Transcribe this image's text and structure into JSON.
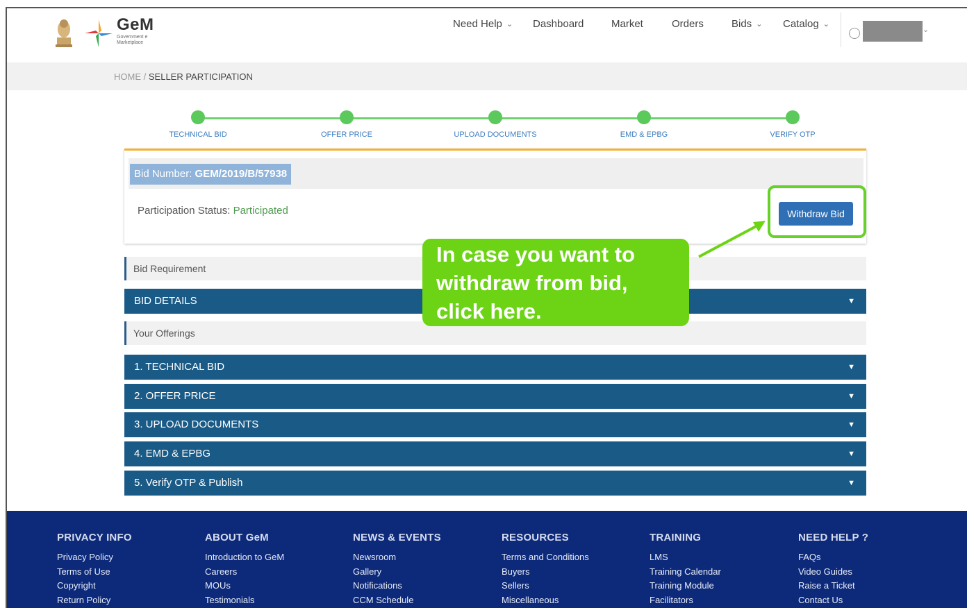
{
  "header": {
    "logo_text": "GeM",
    "logo_sub": "Government e Marketplace",
    "nav": [
      {
        "label": "Need Help",
        "dropdown": true
      },
      {
        "label": "Dashboard",
        "dropdown": false
      },
      {
        "label": "Market",
        "dropdown": false
      },
      {
        "label": "Orders",
        "dropdown": false
      },
      {
        "label": "Bids",
        "dropdown": true
      },
      {
        "label": "Catalog",
        "dropdown": true
      }
    ]
  },
  "breadcrumb": {
    "home": "HOME",
    "sep": "/",
    "current": "SELLER PARTICIPATION"
  },
  "steps": [
    "TECHNICAL BID",
    "OFFER PRICE",
    "UPLOAD DOCUMENTS",
    "EMD & EPBG",
    "VERIFY OTP"
  ],
  "bid": {
    "number_label": "Bid Number:",
    "number_value": "GEM/2019/B/57938",
    "status_label": "Participation Status:",
    "status_value": "Participated",
    "withdraw_label": "Withdraw Bid"
  },
  "sections": {
    "bid_requirement": "Bid Requirement",
    "bid_details": "BID DETAILS",
    "your_offerings": "Your Offerings",
    "offerings": [
      "1. TECHNICAL BID",
      "2. OFFER PRICE",
      "3. UPLOAD DOCUMENTS",
      "4. EMD & EPBG",
      "5. Verify OTP & Publish"
    ]
  },
  "callout": {
    "text": "In case you want to withdraw from bid, click here."
  },
  "footer": {
    "columns": [
      {
        "title": "PRIVACY INFO",
        "links": [
          "Privacy Policy",
          "Terms of Use",
          "Copyright",
          "Return Policy"
        ]
      },
      {
        "title": "ABOUT GeM",
        "links": [
          "Introduction to GeM",
          "Careers",
          "MOUs",
          "Testimonials"
        ]
      },
      {
        "title": "NEWS & EVENTS",
        "links": [
          "Newsroom",
          "Gallery",
          "Notifications",
          "CCM Schedule"
        ]
      },
      {
        "title": "RESOURCES",
        "links": [
          "Terms and Conditions",
          "Buyers",
          "Sellers",
          "Miscellaneous"
        ]
      },
      {
        "title": "TRAINING",
        "links": [
          "LMS",
          "Training Calendar",
          "Training Module",
          "Facilitators"
        ]
      },
      {
        "title": "NEED HELP ?",
        "links": [
          "FAQs",
          "Video Guides",
          "Raise a Ticket",
          "Contact Us"
        ]
      }
    ]
  },
  "colors": {
    "accent_green": "#6cd414",
    "accordion_blue": "#1a5a86",
    "footer_navy": "#0d2a7a",
    "step_green": "#5cc95c"
  }
}
